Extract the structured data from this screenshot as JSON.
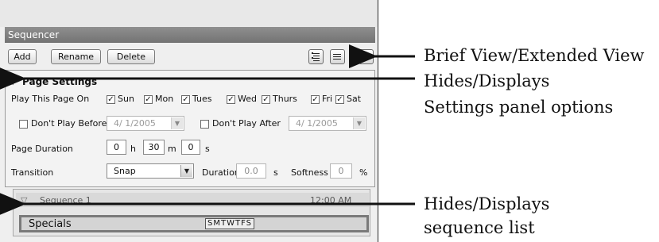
{
  "panel": {
    "title": "Sequencer",
    "toolbar": {
      "add_label": "Add",
      "rename_label": "Rename",
      "delete_label": "Delete",
      "expand_glyph": "»"
    },
    "icons": {
      "brief_view": "list-brief-icon",
      "extended_view": "list-extended-icon"
    }
  },
  "page_settings": {
    "header": "Page Settings",
    "play_on": {
      "label": "Play This Page On",
      "days": [
        {
          "label": "Sun",
          "checked": true
        },
        {
          "label": "Mon",
          "checked": true
        },
        {
          "label": "Tues",
          "checked": true
        },
        {
          "label": "Wed",
          "checked": true
        },
        {
          "label": "Thurs",
          "checked": true
        },
        {
          "label": "Fri",
          "checked": true
        },
        {
          "label": "Sat",
          "checked": true
        }
      ]
    },
    "dont_play_before": {
      "label": "Don't Play Before",
      "date": "4/ 1/2005",
      "checked": false
    },
    "dont_play_after": {
      "label": "Don't Play After",
      "date": "4/ 1/2005",
      "checked": false
    },
    "duration": {
      "label": "Page Duration",
      "hours": "0",
      "h_unit": "h",
      "minutes": "30",
      "m_unit": "m",
      "seconds": "0",
      "s_unit": "s"
    },
    "transition": {
      "label": "Transition",
      "value": "Snap",
      "duration_label": "Duration",
      "duration_value": "0.0",
      "duration_unit": "s",
      "softness_label": "Softness",
      "softness_value": "0",
      "softness_unit": "%"
    }
  },
  "sequence_list": {
    "sequence_label": "Sequence 1",
    "sequence_time": "12:00 AM",
    "item": {
      "name": "Specials",
      "days": "SMTWTFS"
    }
  },
  "callouts": {
    "brief_extended": "Brief View/Extended View",
    "settings_line1": "Hides/Displays",
    "settings_line2": "Settings panel options",
    "sequence_line1": "Hides/Displays",
    "sequence_line2": "sequence list"
  },
  "colors": {
    "title_bar": "#7f7f7f",
    "panel_bg": "#efefef",
    "arrow": "#111111"
  }
}
